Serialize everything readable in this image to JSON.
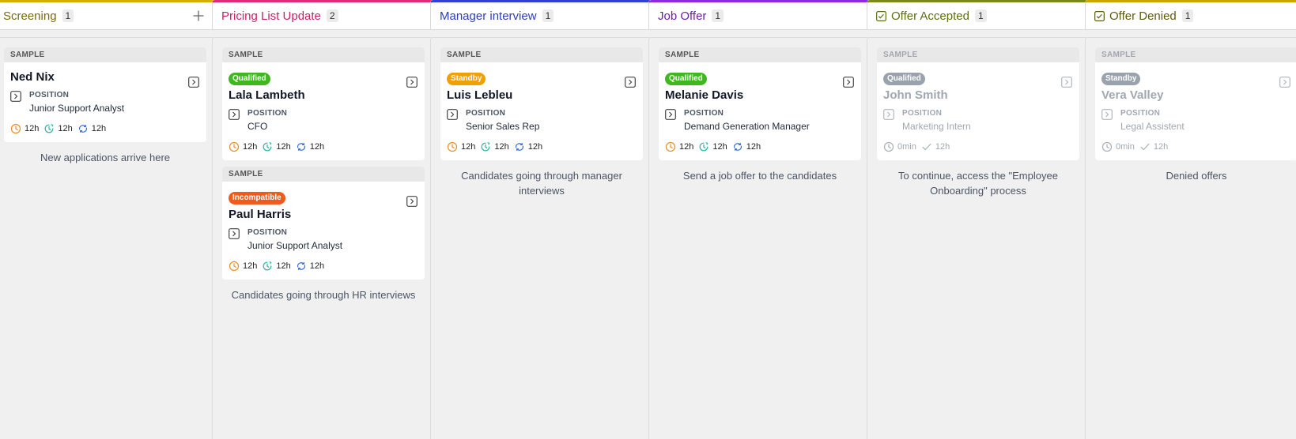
{
  "columns": [
    {
      "title": "Screening",
      "count": "1",
      "color": "#7a6a10",
      "bar": "#d4b100",
      "has_add": true,
      "check_icon": false,
      "description": "New applications arrive here",
      "cards": [
        {
          "sample": "SAMPLE",
          "badge": "",
          "badge_color": "",
          "name": "Ned Nix",
          "position_label": "POSITION",
          "position": "Junior Support Analyst",
          "m1": "12h",
          "m2": "12h",
          "m3": "12h",
          "faded": false,
          "done": false
        }
      ]
    },
    {
      "title": "Pricing List Update",
      "count": "2",
      "color": "#cc1d6b",
      "bar": "#e5287a",
      "has_add": false,
      "check_icon": false,
      "description": "Candidates going through HR interviews",
      "cards": [
        {
          "sample": "SAMPLE",
          "badge": "Qualified",
          "badge_color": "#3fb81f",
          "name": "Lala Lambeth",
          "position_label": "POSITION",
          "position": "CFO",
          "m1": "12h",
          "m2": "12h",
          "m3": "12h",
          "faded": false,
          "done": false
        },
        {
          "sample": "SAMPLE",
          "badge": "Incompatible",
          "badge_color": "#f05a1a",
          "name": "Paul Harris",
          "position_label": "POSITION",
          "position": "Junior Support Analyst",
          "m1": "12h",
          "m2": "12h",
          "m3": "12h",
          "faded": false,
          "done": false
        }
      ]
    },
    {
      "title": "Manager interview",
      "count": "1",
      "color": "#2d3fb8",
      "bar": "#3042d4",
      "has_add": false,
      "check_icon": false,
      "description": "Candidates going through manager interviews",
      "cards": [
        {
          "sample": "SAMPLE",
          "badge": "Standby",
          "badge_color": "#f0a000",
          "name": "Luis Lebleu",
          "position_label": "POSITION",
          "position": "Senior Sales Rep",
          "m1": "12h",
          "m2": "12h",
          "m3": "12h",
          "faded": false,
          "done": false
        }
      ]
    },
    {
      "title": "Job Offer",
      "count": "1",
      "color": "#6a1fb0",
      "bar": "#8a2be2",
      "has_add": false,
      "check_icon": false,
      "description": "Send a job offer to the candidates",
      "cards": [
        {
          "sample": "SAMPLE",
          "badge": "Qualified",
          "badge_color": "#3fb81f",
          "name": "Melanie Davis",
          "position_label": "POSITION",
          "position": "Demand Generation Manager",
          "m1": "12h",
          "m2": "12h",
          "m3": "12h",
          "faded": false,
          "done": false
        }
      ]
    },
    {
      "title": "Offer Accepted",
      "count": "1",
      "color": "#5e6e12",
      "bar": "#7a8a16",
      "has_add": false,
      "check_icon": true,
      "description": "To continue, access the \"Employee Onboarding\" process",
      "cards": [
        {
          "sample": "SAMPLE",
          "badge": "Qualified",
          "badge_color": "#9aa3ad",
          "name": "John Smith",
          "position_label": "POSITION",
          "position": "Marketing Intern",
          "m1": "0min",
          "m2": "12h",
          "m3": "",
          "faded": true,
          "done": true
        }
      ]
    },
    {
      "title": "Offer Denied",
      "count": "1",
      "color": "#5e5a12",
      "bar": "#c8a800",
      "has_add": false,
      "check_icon": true,
      "description": "Denied offers",
      "cards": [
        {
          "sample": "SAMPLE",
          "badge": "Standby",
          "badge_color": "#9aa3ad",
          "name": "Vera Valley",
          "position_label": "POSITION",
          "position": "Legal Assistent",
          "m1": "0min",
          "m2": "12h",
          "m3": "",
          "faded": true,
          "done": true
        }
      ]
    }
  ]
}
